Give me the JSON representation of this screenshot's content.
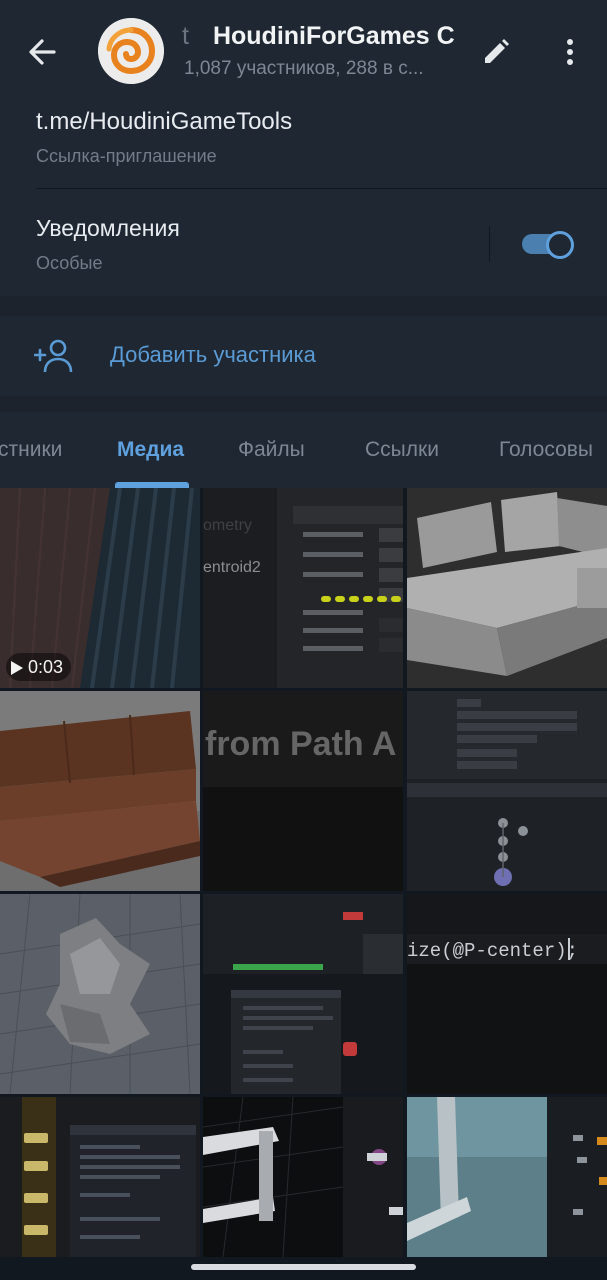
{
  "header": {
    "title_prefix": "t",
    "title": "HoudiniForGames C",
    "subtitle": "1,087 участников, 288 в с..."
  },
  "info": {
    "link": "t.me/HoudiniGameTools",
    "link_caption": "Ссылка-приглашение",
    "notifications_label": "Уведомления",
    "notifications_value": "Особые",
    "notifications_enabled": true
  },
  "add_member": {
    "label": "Добавить участника"
  },
  "tabs": [
    {
      "label": "стники",
      "active": false
    },
    {
      "label": "Медиа",
      "active": true
    },
    {
      "label": "Файлы",
      "active": false
    },
    {
      "label": "Ссылки",
      "active": false
    },
    {
      "label": "Голосовы",
      "active": false
    }
  ],
  "media": [
    {
      "kind": "video",
      "duration": "0:03",
      "alt": "striped-fabric"
    },
    {
      "kind": "image",
      "alt": "houdini-extract-centroid-params",
      "text": "entroid2"
    },
    {
      "kind": "image",
      "alt": "grey-sofa-render"
    },
    {
      "kind": "image",
      "alt": "brown-sofa-bed-render"
    },
    {
      "kind": "image",
      "alt": "blurred-title-slide",
      "text": "from Path A"
    },
    {
      "kind": "image",
      "alt": "houdini-node-params"
    },
    {
      "kind": "image",
      "alt": "rock-sculpt-viewport"
    },
    {
      "kind": "image",
      "alt": "houdini-vex-editor"
    },
    {
      "kind": "image",
      "alt": "vex-code-snippet",
      "text": "ize(@P-center);"
    },
    {
      "kind": "image",
      "alt": "houdini-network-wrangle"
    },
    {
      "kind": "image",
      "alt": "wireframe-viewport"
    },
    {
      "kind": "image",
      "alt": "sky-viewport-nodes"
    }
  ],
  "colors": {
    "accent": "#5ea1de",
    "background": "#1c232c",
    "panel": "#1f2832"
  }
}
